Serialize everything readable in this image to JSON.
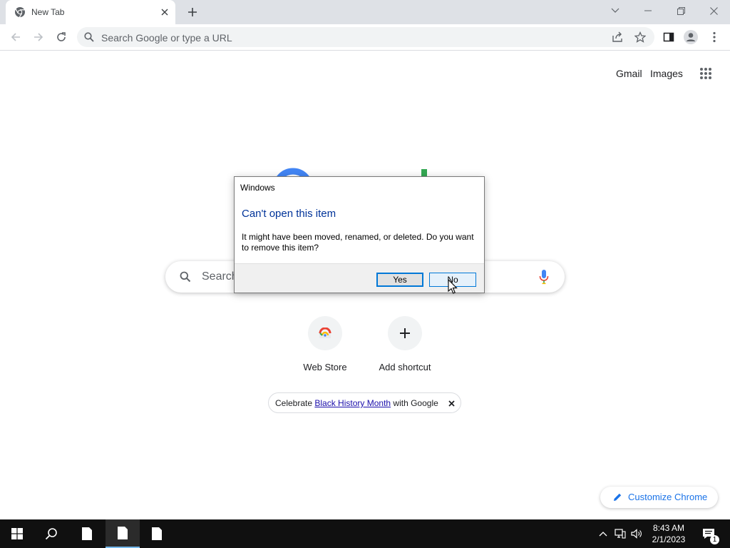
{
  "browser": {
    "tab": {
      "title": "New Tab"
    },
    "omnibox": {
      "placeholder": "Search Google or type a URL"
    }
  },
  "ntp": {
    "links": {
      "gmail": "Gmail",
      "images": "Images"
    },
    "search": {
      "placeholder": "Search"
    },
    "shortcuts": [
      {
        "label": "Web Store",
        "icon": "webstore-icon"
      },
      {
        "label": "Add shortcut",
        "icon": "plus-icon"
      }
    ],
    "promo": {
      "prefix": "Celebrate ",
      "link": "Black History Month",
      "suffix": " with Google"
    },
    "customize": {
      "label": "Customize Chrome"
    }
  },
  "dialog": {
    "title": "Windows",
    "heading": "Can't open this item",
    "message": "It might have been moved, renamed, or deleted. Do you want to remove this item?",
    "buttons": {
      "yes": "Yes",
      "no": "No"
    }
  },
  "taskbar": {
    "clock": {
      "time": "8:43 AM",
      "date": "2/1/2023"
    },
    "notification_count": "1"
  },
  "colors": {
    "accent": "#1a73e8",
    "dialog_heading": "#003399",
    "taskbar": "#101010",
    "tabstrip": "#dee1e6"
  }
}
